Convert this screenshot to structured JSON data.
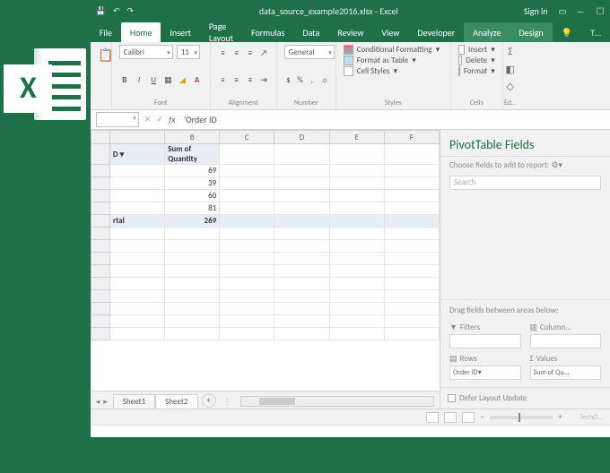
{
  "titlebar": {
    "document": "data_source_example2016.xlsx - Excel",
    "signin": "Sign in"
  },
  "tabs": {
    "file": "File",
    "home": "Home",
    "insert": "Insert",
    "pagelayout": "Page Layout",
    "formulas": "Formulas",
    "data": "Data",
    "review": "Review",
    "view": "View",
    "developer": "Developer",
    "analyze": "Analyze",
    "design": "Design",
    "tell": "T…"
  },
  "ribbon": {
    "font_name": "Calibri",
    "font_size": "11",
    "number_format": "General",
    "cond_fmt": "Conditional Formatting",
    "as_table": "Format as Table",
    "cell_styles": "Cell Styles",
    "insert": "Insert",
    "delete": "Delete",
    "format": "Format",
    "group_font": "Font",
    "group_align": "Alignment",
    "group_number": "Number",
    "group_styles": "Styles",
    "group_cells": "Cells",
    "group_edit": "Ed…"
  },
  "formula_bar": {
    "content": "'Order ID"
  },
  "columns": [
    "",
    "B",
    "C",
    "D",
    "E",
    "F"
  ],
  "sheet": {
    "header_a": "D",
    "header_b": "Sum of Quantity",
    "rows": [
      "69",
      "39",
      "60",
      "81"
    ],
    "total_label": "rtal",
    "total_value": "269"
  },
  "sheets": {
    "s1": "Sheet1",
    "s2": "Sheet2",
    "add": "+"
  },
  "pane": {
    "title": "PivotTable Fields",
    "sub": "Choose fields to add to report:",
    "search_ph": "Search",
    "drag": "Drag fields between areas below:",
    "filters": "Filters",
    "columns": "Column…",
    "rows": "Rows",
    "values": "Values",
    "row_item": "Order ID",
    "val_item": "Sum of Qu…",
    "defer": "Defer Layout Update"
  },
  "status": {
    "brand": "TechO…"
  }
}
